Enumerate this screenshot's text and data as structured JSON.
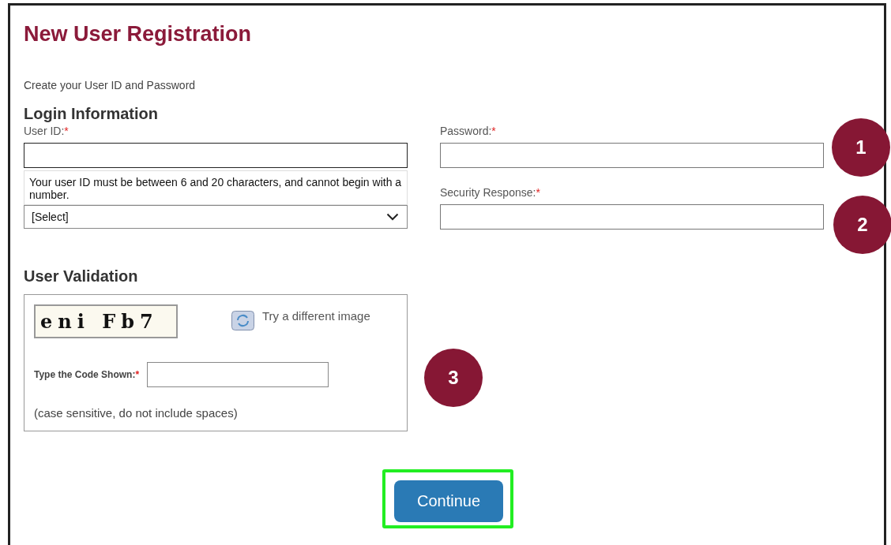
{
  "title": "New User Registration",
  "subtitle": "Create your User ID and Password",
  "login": {
    "heading": "Login Information",
    "user_id": {
      "label": "User ID:",
      "required": "*",
      "hint": "Your user ID must be between 6 and 20 characters, and cannot begin with a number."
    },
    "question_select": {
      "value": "[Select]"
    },
    "password": {
      "label": "Password:",
      "required": "*"
    },
    "security_response": {
      "label": "Security Response:",
      "required": "*"
    }
  },
  "validation": {
    "heading": "User Validation",
    "captcha_text": "eni Fb7",
    "refresh_label": "Try a different image",
    "code_label": "Type the Code Shown:",
    "code_required": "*",
    "note": "(case sensitive, do not include spaces)"
  },
  "continue_button": "Continue",
  "callouts": [
    {
      "number": "1"
    },
    {
      "number": "2"
    },
    {
      "number": "3"
    }
  ]
}
